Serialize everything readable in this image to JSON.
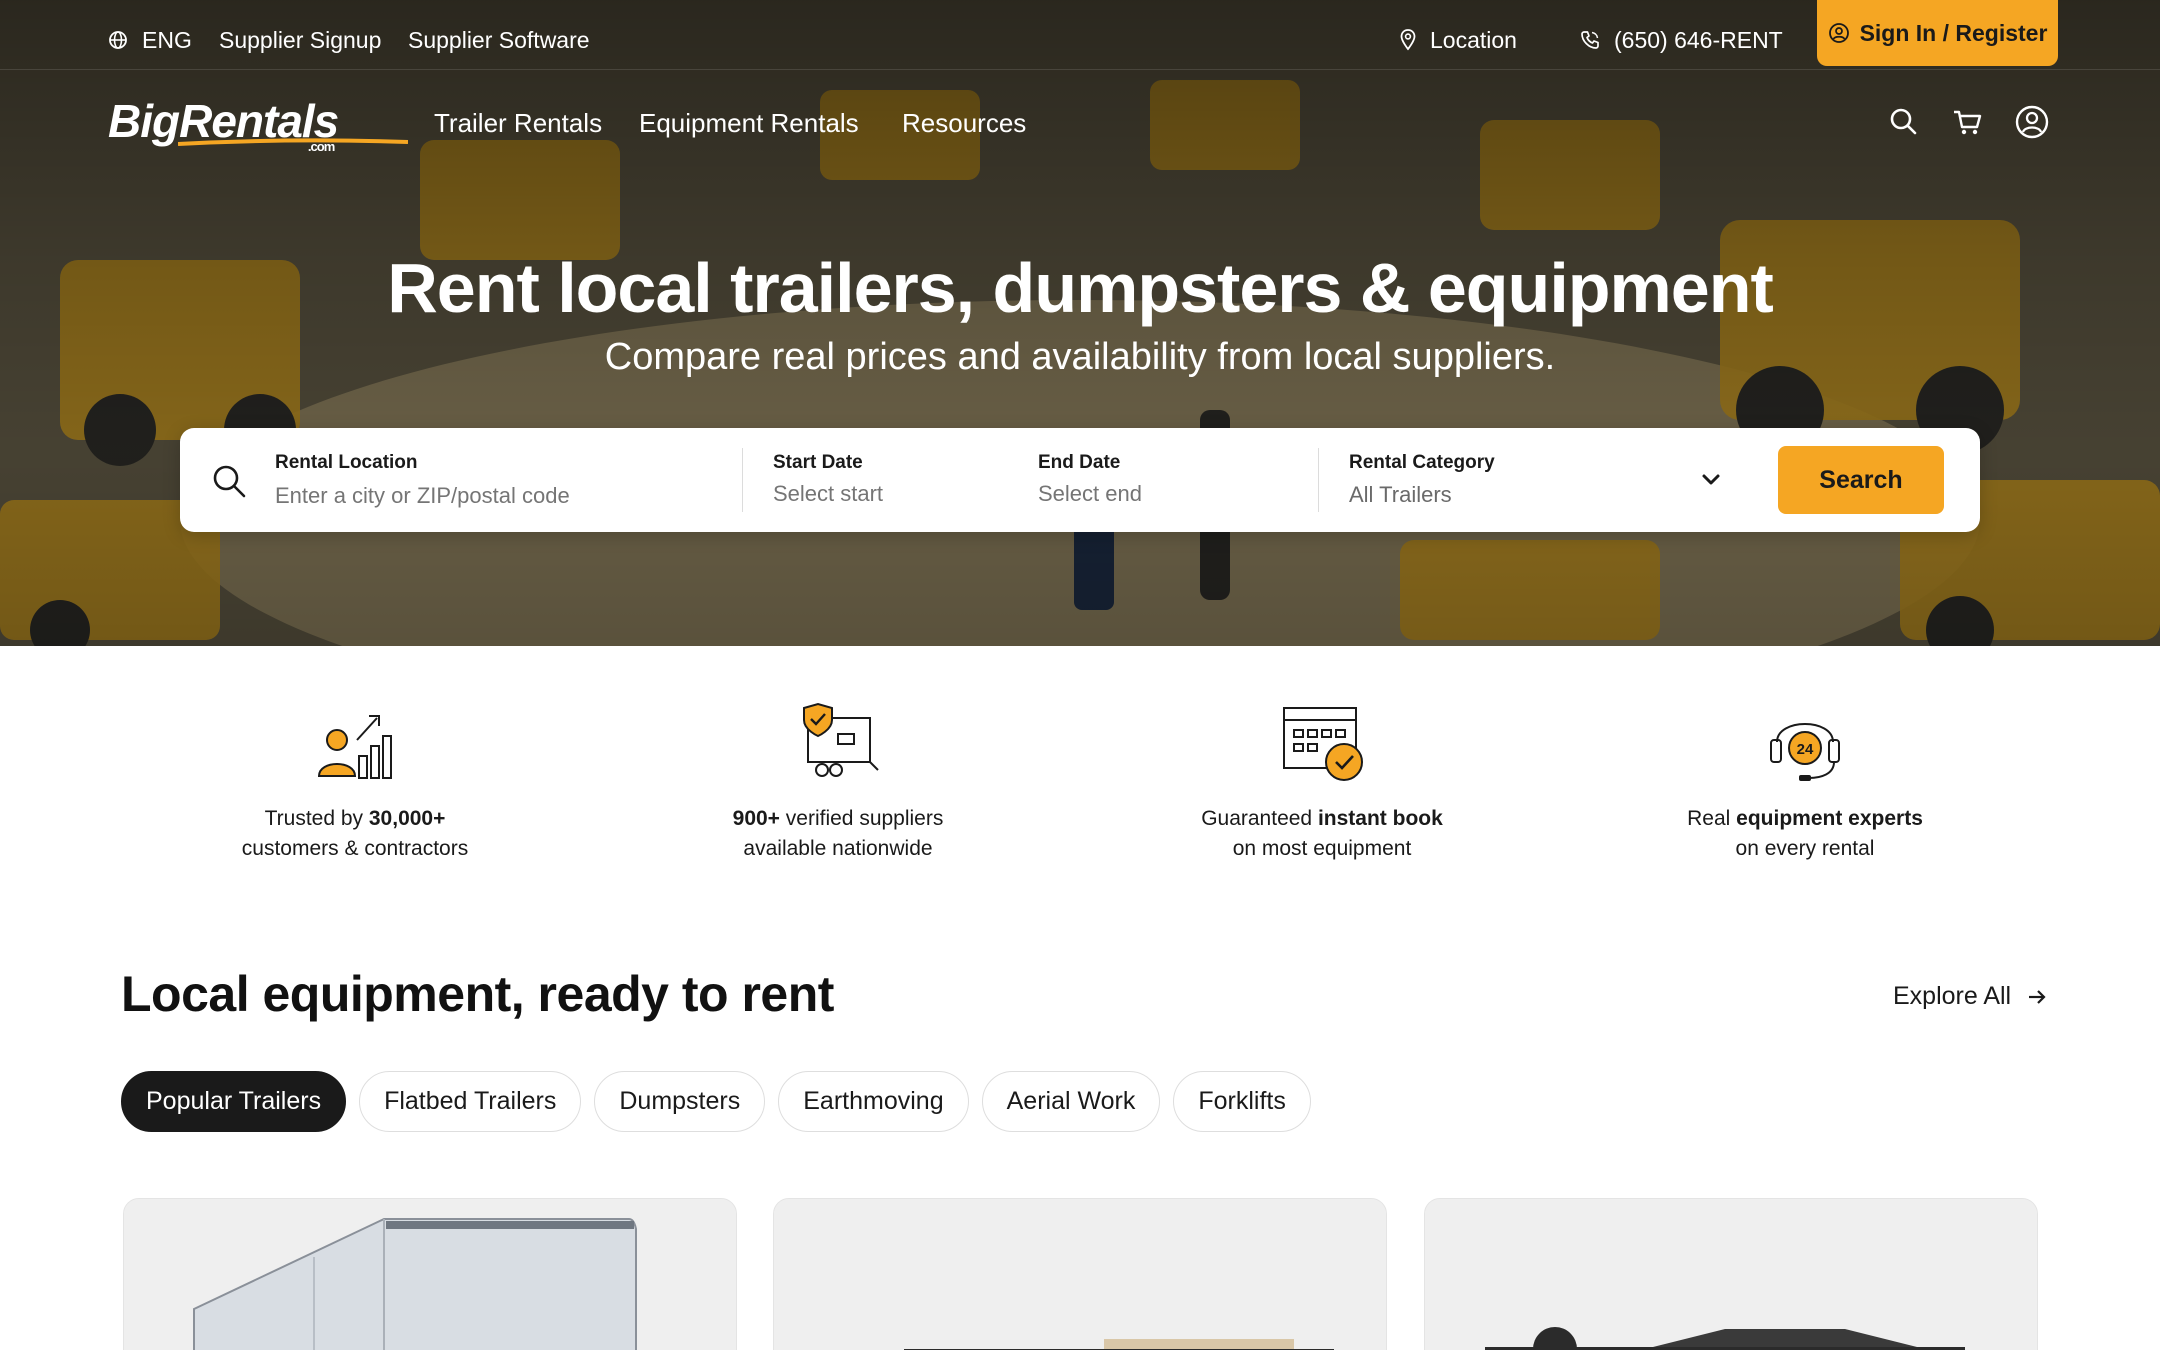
{
  "topbar": {
    "language": "ENG",
    "supplier_signup": "Supplier Signup",
    "supplier_software": "Supplier Software",
    "location": "Location",
    "phone": "(650) 646-RENT",
    "signin": "Sign In / Register"
  },
  "logo": {
    "brand": "BigRentals",
    "suffix": ".com"
  },
  "nav": {
    "items": [
      "Trailer Rentals",
      "Equipment Rentals",
      "Resources"
    ]
  },
  "hero": {
    "title": "Rent local trailers, dumpsters & equipment",
    "subtitle": "Compare real prices and availability from local suppliers."
  },
  "search": {
    "location_label": "Rental Location",
    "location_placeholder": "Enter a city or ZIP/postal code",
    "start_label": "Start Date",
    "start_placeholder": "Select start",
    "end_label": "End Date",
    "end_placeholder": "Select end",
    "category_label": "Rental Category",
    "category_value": "All Trailers",
    "button": "Search"
  },
  "features": [
    {
      "pre": "Trusted by ",
      "bold": "30,000+",
      "post": "",
      "line2": "customers & contractors",
      "icon": "trusted-customers-icon"
    },
    {
      "pre": "",
      "bold": "900+",
      "post": " verified suppliers",
      "line2": "available nationwide",
      "icon": "verified-suppliers-icon"
    },
    {
      "pre": "Guaranteed ",
      "bold": "instant book",
      "post": "",
      "line2": "on most equipment",
      "icon": "instant-book-icon"
    },
    {
      "pre": "Real ",
      "bold": "equipment experts",
      "post": "",
      "line2": "on every rental",
      "icon": "support-24-icon"
    }
  ],
  "support_badge": "24",
  "section": {
    "title": "Local equipment, ready to rent",
    "explore": "Explore All",
    "tabs": [
      "Popular Trailers",
      "Flatbed Trailers",
      "Dumpsters",
      "Earthmoving",
      "Aerial Work",
      "Forklifts"
    ],
    "active_tab": "Popular Trailers"
  },
  "colors": {
    "accent": "#f5a623",
    "dark": "#1a1a1a"
  }
}
